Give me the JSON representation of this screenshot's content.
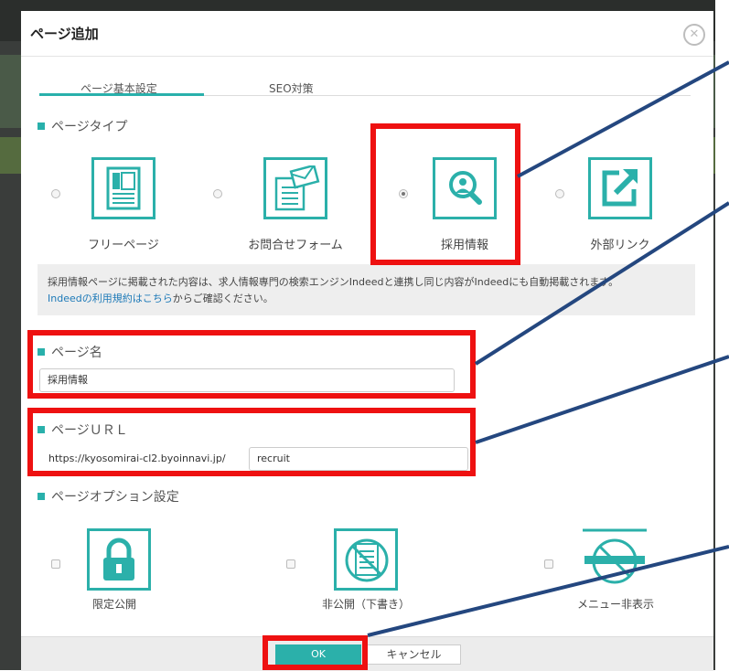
{
  "modal": {
    "title": "ページ追加",
    "close_icon": "close-icon"
  },
  "tabs": [
    {
      "label": "ページ基本設定",
      "active": true
    },
    {
      "label": "SEO対策",
      "active": false
    }
  ],
  "page_type": {
    "heading": "ページタイプ",
    "options": [
      {
        "label": "フリーページ",
        "icon": "free-page-icon",
        "selected": false
      },
      {
        "label": "お問合せフォーム",
        "icon": "contact-form-icon",
        "selected": false
      },
      {
        "label": "採用情報",
        "icon": "recruit-search-icon",
        "selected": true
      },
      {
        "label": "外部リンク",
        "icon": "external-link-icon",
        "selected": false
      }
    ],
    "notice_line1": "採用情報ページに掲載された内容は、求人情報専門の検索エンジンIndeedと連携し同じ内容がIndeedにも自動掲載されます。",
    "notice_link": "Indeedの利用規約はこちら",
    "notice_line2_rest": "からご確認ください。"
  },
  "page_name": {
    "heading": "ページ名",
    "value": "採用情報"
  },
  "page_url": {
    "heading": "ページＵＲＬ",
    "prefix": "https://kyosomirai-cl2.byoinnavi.jp/",
    "value": "recruit"
  },
  "page_options": {
    "heading": "ページオプション設定",
    "options": [
      {
        "label": "限定公開",
        "icon": "lock-icon",
        "checked": false
      },
      {
        "label": "非公開（下書き）",
        "icon": "no-document-icon",
        "checked": false
      },
      {
        "label": "メニュー非表示",
        "icon": "no-menu-icon",
        "checked": false
      }
    ]
  },
  "footer": {
    "ok_label": "OK",
    "cancel_label": "キャンセル"
  },
  "colors": {
    "accent": "#2bb0aa",
    "highlight": "#ee1111",
    "callout_line": "#24477f"
  }
}
